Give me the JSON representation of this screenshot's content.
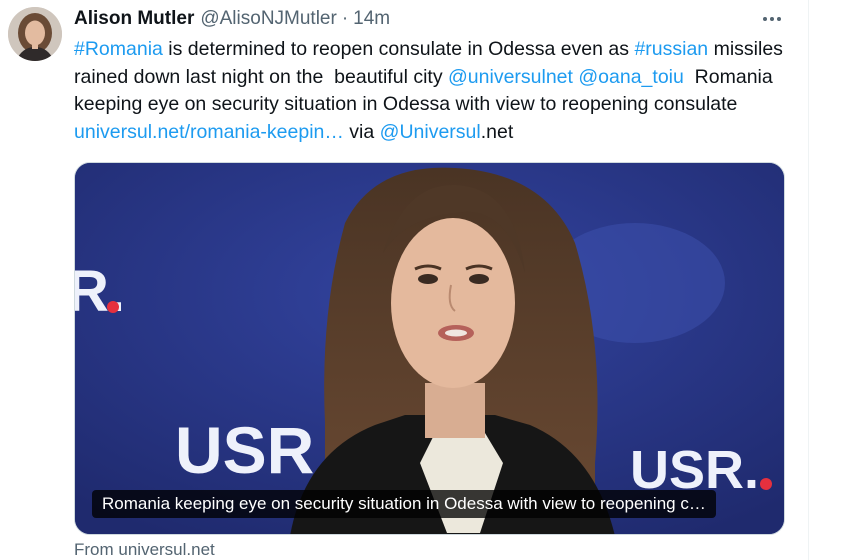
{
  "tweet": {
    "author": {
      "display_name": "Alison Mutler",
      "handle": "@AlisoNJMutler",
      "separator": "·",
      "time": "14m"
    },
    "text_segments": [
      {
        "text": "#Romania",
        "link": true
      },
      {
        "text": " is determined to reopen consulate in Odessa even as ",
        "link": false
      },
      {
        "text": "#russian",
        "link": true
      },
      {
        "text": " missiles rained down last night on the  beautiful city ",
        "link": false
      },
      {
        "text": "@universulnet",
        "link": true
      },
      {
        "text": " ",
        "link": false
      },
      {
        "text": "@oana_toiu",
        "link": true
      },
      {
        "text": "  Romania keeping eye on security situation in Odessa with view to reopening consulate ",
        "link": false
      },
      {
        "text": "universul.net/romania-keepin…",
        "link": true
      },
      {
        "text": " via ",
        "link": false
      },
      {
        "text": "@Universul",
        "link": true
      },
      {
        "text": ".net",
        "link": false
      }
    ],
    "card": {
      "caption": "Romania keeping eye on security situation in Odessa with view to reopening c…",
      "source": "From universul.net",
      "backdrop_text_left": "R.",
      "backdrop_text_bottom_left": "USR",
      "backdrop_text_bottom_right": "USR."
    }
  },
  "icons": {
    "more": "more-horizontal-icon"
  },
  "colors": {
    "link": "#1d9bf0",
    "text": "#0f1419",
    "secondary": "#536471",
    "backdrop": "#26337a",
    "logo_dot": "#e5303e"
  }
}
